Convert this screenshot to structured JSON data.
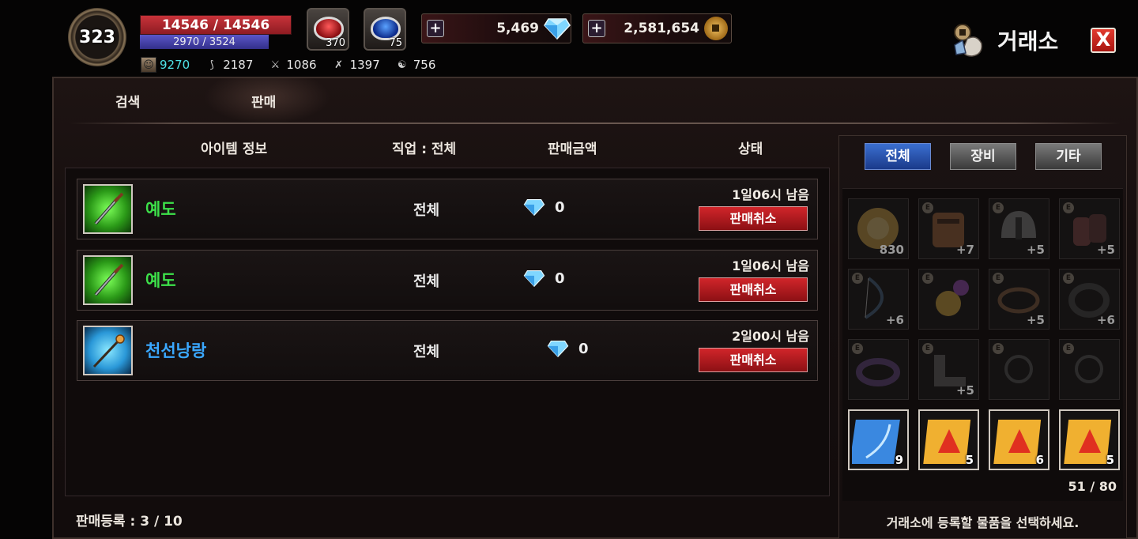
{
  "player": {
    "level": "323",
    "hp": "14546 / 14546",
    "mp": "2970 / 3524",
    "stats": [
      {
        "icon": "portrait-icon",
        "value": "9270"
      },
      {
        "icon": "bow-icon",
        "value": "2187"
      },
      {
        "icon": "sword-icon",
        "value": "1086"
      },
      {
        "icon": "crossbow-icon",
        "value": "1397"
      },
      {
        "icon": "spirit-icon",
        "value": "756"
      }
    ]
  },
  "potions": {
    "red_count": "370",
    "blue_count": "75"
  },
  "currency": {
    "gems": "5,469",
    "coins": "2,581,654",
    "plus": "+"
  },
  "window": {
    "title": "거래소",
    "close": "X"
  },
  "tabs": {
    "search": "검색",
    "sell": "판매"
  },
  "columns": {
    "item_info": "아이템 정보",
    "job": "직업 : 전체",
    "price": "판매금액",
    "status": "상태"
  },
  "listings": [
    {
      "name": "예도",
      "rarity": "green",
      "job": "전체",
      "price": "0",
      "time": "1일06시 남음",
      "action": "판매취소"
    },
    {
      "name": "예도",
      "rarity": "green",
      "job": "전체",
      "price": "0",
      "time": "1일06시 남음",
      "action": "판매취소"
    },
    {
      "name": "천선낭랑",
      "rarity": "blue",
      "job": "전체",
      "price": "0",
      "time": "2일00시 남음",
      "action": "판매취소"
    }
  ],
  "sale_count": "판매등록 : 3 / 10",
  "inventory": {
    "tabs": [
      "전체",
      "장비",
      "기타"
    ],
    "active_tab": "전체",
    "items": [
      {
        "kind": "gold-ring-plate",
        "equip": false,
        "qty": "830",
        "bright": false
      },
      {
        "kind": "armor",
        "equip": true,
        "qty": "+7",
        "bright": false
      },
      {
        "kind": "helmet",
        "equip": true,
        "qty": "+5",
        "bright": false
      },
      {
        "kind": "gloves",
        "equip": true,
        "qty": "+5",
        "bright": false
      },
      {
        "kind": "bow",
        "equip": true,
        "qty": "+6",
        "bright": false
      },
      {
        "kind": "necklace",
        "equip": true,
        "qty": "",
        "bright": false
      },
      {
        "kind": "belt",
        "equip": true,
        "qty": "+5",
        "bright": false
      },
      {
        "kind": "bracelet",
        "equip": true,
        "qty": "+6",
        "bright": false
      },
      {
        "kind": "ring",
        "equip": true,
        "qty": "",
        "bright": false
      },
      {
        "kind": "boots",
        "equip": true,
        "qty": "+5",
        "bright": false
      },
      {
        "kind": "earring",
        "equip": true,
        "qty": "",
        "bright": false
      },
      {
        "kind": "earring",
        "equip": true,
        "qty": "",
        "bright": false
      },
      {
        "kind": "blue-scroll",
        "equip": false,
        "qty": "9",
        "bright": true
      },
      {
        "kind": "red-scroll",
        "equip": false,
        "qty": "5",
        "bright": true
      },
      {
        "kind": "red-scroll",
        "equip": false,
        "qty": "6",
        "bright": true
      },
      {
        "kind": "red-scroll",
        "equip": false,
        "qty": "5",
        "bright": true
      }
    ],
    "equip_mark": "E",
    "count": "51 / 80",
    "hint": "거래소에 등록할 물품을 선택하세요."
  },
  "colors": {
    "green_name": "#3de04a",
    "blue_name": "#3aa8ff",
    "cancel_button": "#c0181e",
    "hp": "#c8333a",
    "mp": "#4a46b8"
  }
}
